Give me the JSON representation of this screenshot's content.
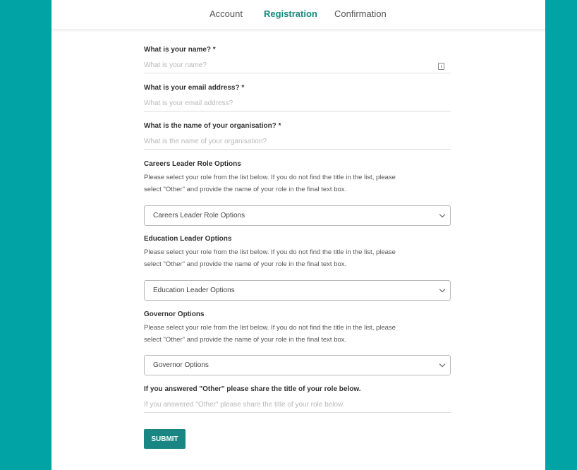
{
  "colors": {
    "teal_background": "#01a3a4",
    "accent": "#16897f",
    "button": "#1a8683"
  },
  "tabs": [
    {
      "label": "Account",
      "active": false
    },
    {
      "label": "Registration",
      "active": true
    },
    {
      "label": "Confirmation",
      "active": false
    }
  ],
  "form": {
    "name": {
      "label": "What is your name? *",
      "placeholder": "What is your name?",
      "icon": "form-field-icon"
    },
    "email": {
      "label": "What is your email address? *",
      "placeholder": "What is your email address?"
    },
    "organisation": {
      "label": "What is the name of your organisation? *",
      "placeholder": "What is the name of your organisation?"
    },
    "careers": {
      "label": "Careers Leader Role Options",
      "help_line1": "Please select your role from the list below. If you do not find the title in the list, please",
      "help_line2": "select \"Other\" and provide the name of your role in the final text box.",
      "selected": "Careers Leader Role Options"
    },
    "education": {
      "label": "Education Leader Options",
      "help_line1": "Please select your role from the list below. If you do not find the title in the list, please",
      "help_line2": "select \"Other\" and provide the name of your role in the final text box.",
      "selected": "Education Leader Options"
    },
    "governor": {
      "label": "Governor Options",
      "help_line1": "Please select your role from the list below. If you do not find the title in the list, please",
      "help_line2": "select \"Other\" and provide the name of your role in the final text box.",
      "selected": "Governor Options"
    },
    "other": {
      "label": "If you answered \"Other\" please share the title of your role below.",
      "placeholder": "If you answered \"Other\" please share the title of your role below."
    },
    "submit_label": "SUBMIT"
  }
}
